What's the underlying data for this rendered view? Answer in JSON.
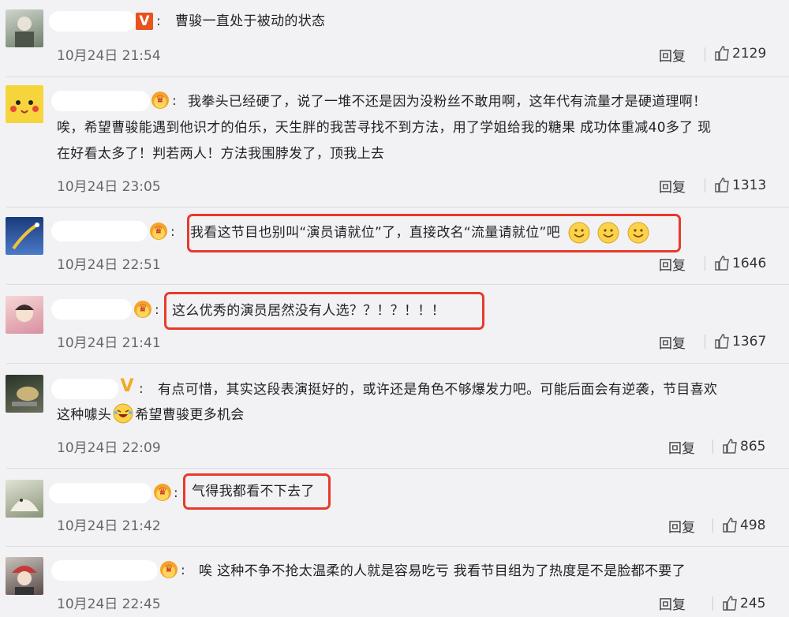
{
  "comments": [
    {
      "text": "曹骏一直处于被动的状态",
      "time": "10月24日 21:54",
      "reply": "回复",
      "likes": "2129",
      "badge": "V",
      "avatar_color": "#7b8a7a"
    },
    {
      "text_lines": [
        "我拳头已经硬了，说了一堆不还是因为没粉丝不敢用啊，这年代有流量才是硬道理啊！",
        "唉，希望曹骏能遇到他识才的伯乐，天生胖的我苦寻找不到方法，用了学姐给我的糖果 成功体重减40多了 现",
        "在好看太多了！判若两人！方法我围脖发了，顶我上去"
      ],
      "time": "10月24日 23:05",
      "reply": "回复",
      "likes": "1313",
      "avatar_color": "#f5d53b"
    },
    {
      "text": "我看这节目也别叫“演员请就位”了，直接改名“流量请就位”吧",
      "time": "10月24日 22:51",
      "reply": "回复",
      "likes": "1646",
      "avatar_color": "#2f5aa8"
    },
    {
      "text": "这么优秀的演员居然没有人选？？！？！！！",
      "time": "10月24日 21:41",
      "reply": "回复",
      "likes": "1367",
      "avatar_color": "#e7b7b7"
    },
    {
      "text_lines": [
        "有点可惜，其实这段表演挺好的，或许还是角色不够爆发力吧。可能后面会有逆袭，节目喜欢",
        "这种噱头",
        "希望曹骏更多机会"
      ],
      "time": "10月24日 22:09",
      "reply": "回复",
      "likes": "865",
      "badge": "V",
      "avatar_color": "#3f4a3a"
    },
    {
      "text": "气得我都看不下去了",
      "time": "10月24日 21:42",
      "reply": "回复",
      "likes": "498",
      "avatar_color": "#9aa38f"
    },
    {
      "text": "唉 这种不争不抢太温柔的人就是容易吃亏 我看节目组为了热度是不是脸都不要了",
      "time": "10月24日 22:45",
      "reply": "回复",
      "likes": "245",
      "avatar_color": "#5a4a4a"
    }
  ],
  "colors": {
    "highlight": "#e83a2a",
    "background": "#f2f2f5"
  }
}
